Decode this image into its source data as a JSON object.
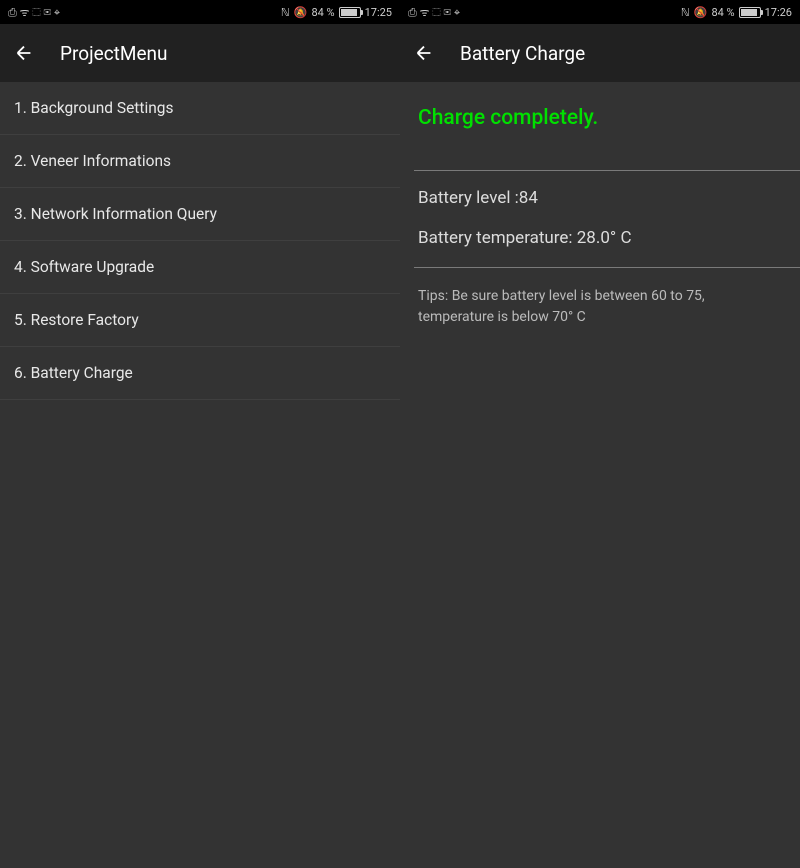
{
  "left_screen": {
    "status": {
      "left_icons": "⎙ ᯤ ⬚ ✉ ⌖",
      "nfc": "ℕ",
      "mute": "🔕",
      "battery_pct": "84 %",
      "time": "17:25"
    },
    "app_bar": {
      "title": "ProjectMenu"
    },
    "menu": {
      "items": [
        {
          "label": "1. Background Settings"
        },
        {
          "label": "2. Veneer Informations"
        },
        {
          "label": "3. Network Information Query"
        },
        {
          "label": "4. Software Upgrade"
        },
        {
          "label": "5. Restore Factory"
        },
        {
          "label": "6. Battery Charge"
        }
      ]
    }
  },
  "right_screen": {
    "status": {
      "left_icons": "⎙ ᯤ ⬚ ✉ ⌖",
      "nfc": "ℕ",
      "mute": "🔕",
      "battery_pct": "84 %",
      "time": "17:26"
    },
    "app_bar": {
      "title": "Battery Charge"
    },
    "charge": {
      "status_text": "Charge completely.",
      "level_label": "Battery level :84",
      "temp_label": "Battery temperature: 28.0° C",
      "tips": "Tips: Be sure battery level is between 60 to 75, temperature is below 70° C"
    }
  }
}
